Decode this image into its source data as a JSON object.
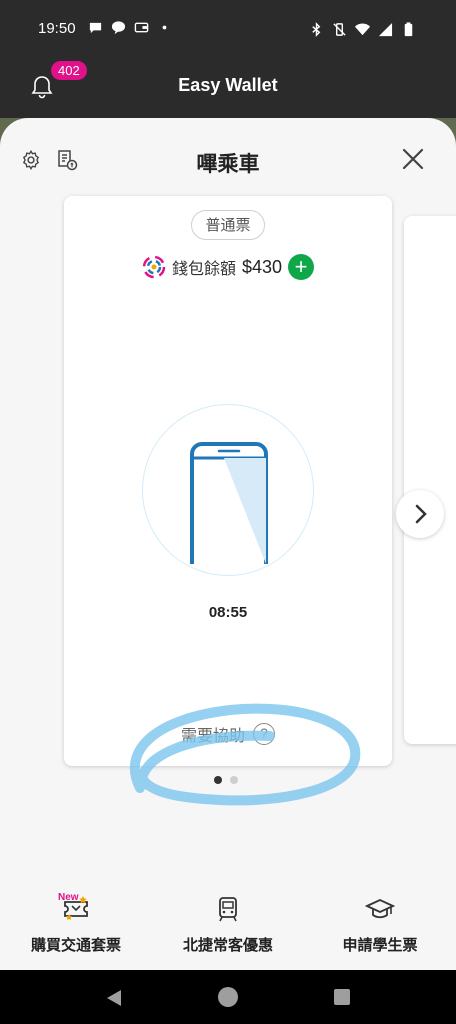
{
  "status_bar": {
    "time": "19:50"
  },
  "header": {
    "title": "Easy Wallet",
    "notification_count": "402"
  },
  "sheet": {
    "title": "嗶乘車"
  },
  "card": {
    "ticket_type": "普通票",
    "balance_label": "錢包餘額",
    "balance_amount": "$430",
    "add_symbol": "+",
    "timer": "08:55",
    "help_label": "需要協助",
    "help_symbol": "?"
  },
  "pager": {
    "total": 2,
    "active": 0
  },
  "tabs": [
    {
      "label": "購買交通套票",
      "badge": "New",
      "icon": "ticket-icon"
    },
    {
      "label": "北捷常客優惠",
      "icon": "train-icon"
    },
    {
      "label": "申請學生票",
      "icon": "graduation-cap-icon"
    }
  ],
  "colors": {
    "accent_green": "#10a64a",
    "badge_pink": "#e0118a",
    "phone_blue": "#1f76b8"
  }
}
